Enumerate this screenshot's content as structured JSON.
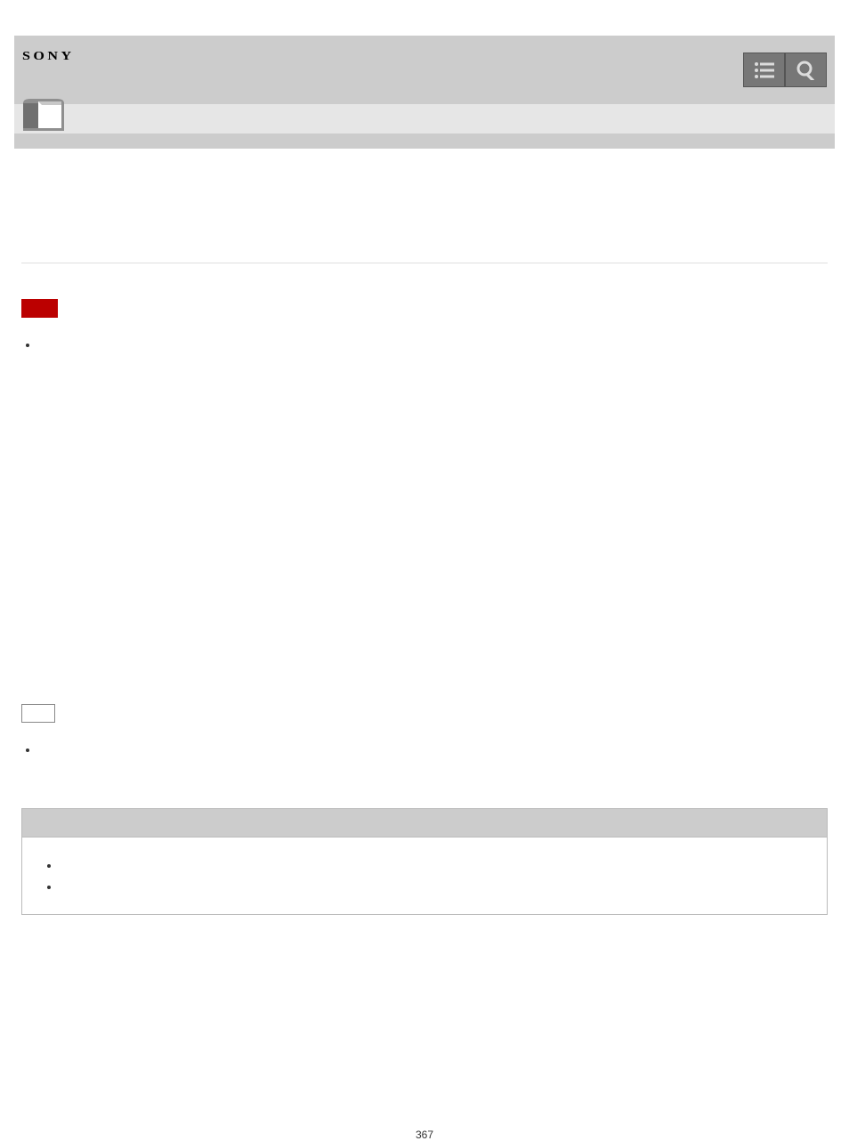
{
  "brand": "SONY",
  "note_label": "",
  "notes": [
    ""
  ],
  "hint_label": "",
  "hints": [
    ""
  ],
  "related": {
    "title": "",
    "items": [
      "",
      ""
    ]
  },
  "page_number": "367"
}
